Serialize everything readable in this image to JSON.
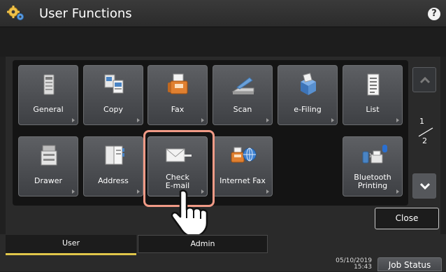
{
  "header": {
    "title": "User Functions",
    "help": "?"
  },
  "tiles": [
    {
      "label": "General",
      "icon": "general-icon"
    },
    {
      "label": "Copy",
      "icon": "copy-icon"
    },
    {
      "label": "Fax",
      "icon": "fax-icon"
    },
    {
      "label": "Scan",
      "icon": "scan-icon"
    },
    {
      "label": "e-Filing",
      "icon": "efiling-icon"
    },
    {
      "label": "List",
      "icon": "list-icon"
    },
    {
      "label": "Drawer",
      "icon": "drawer-icon"
    },
    {
      "label": "Address",
      "icon": "address-book-icon"
    },
    {
      "label1": "Check",
      "label2": "E-mail",
      "icon": "check-email-icon"
    },
    {
      "label": "Internet Fax",
      "icon": "internet-fax-icon"
    },
    {
      "label1": "Bluetooth",
      "label2": "Printing",
      "icon": "bluetooth-printing-icon"
    }
  ],
  "pagination": {
    "current": "1",
    "total": "2"
  },
  "buttons": {
    "close": "Close",
    "job_status": "Job Status"
  },
  "tabs": {
    "user": "User",
    "admin": "Admin"
  },
  "status": {
    "date": "05/10/2019",
    "time": "15:43"
  },
  "colors": {
    "highlight": "#f09a86",
    "active_tab": "#e0c64a"
  }
}
